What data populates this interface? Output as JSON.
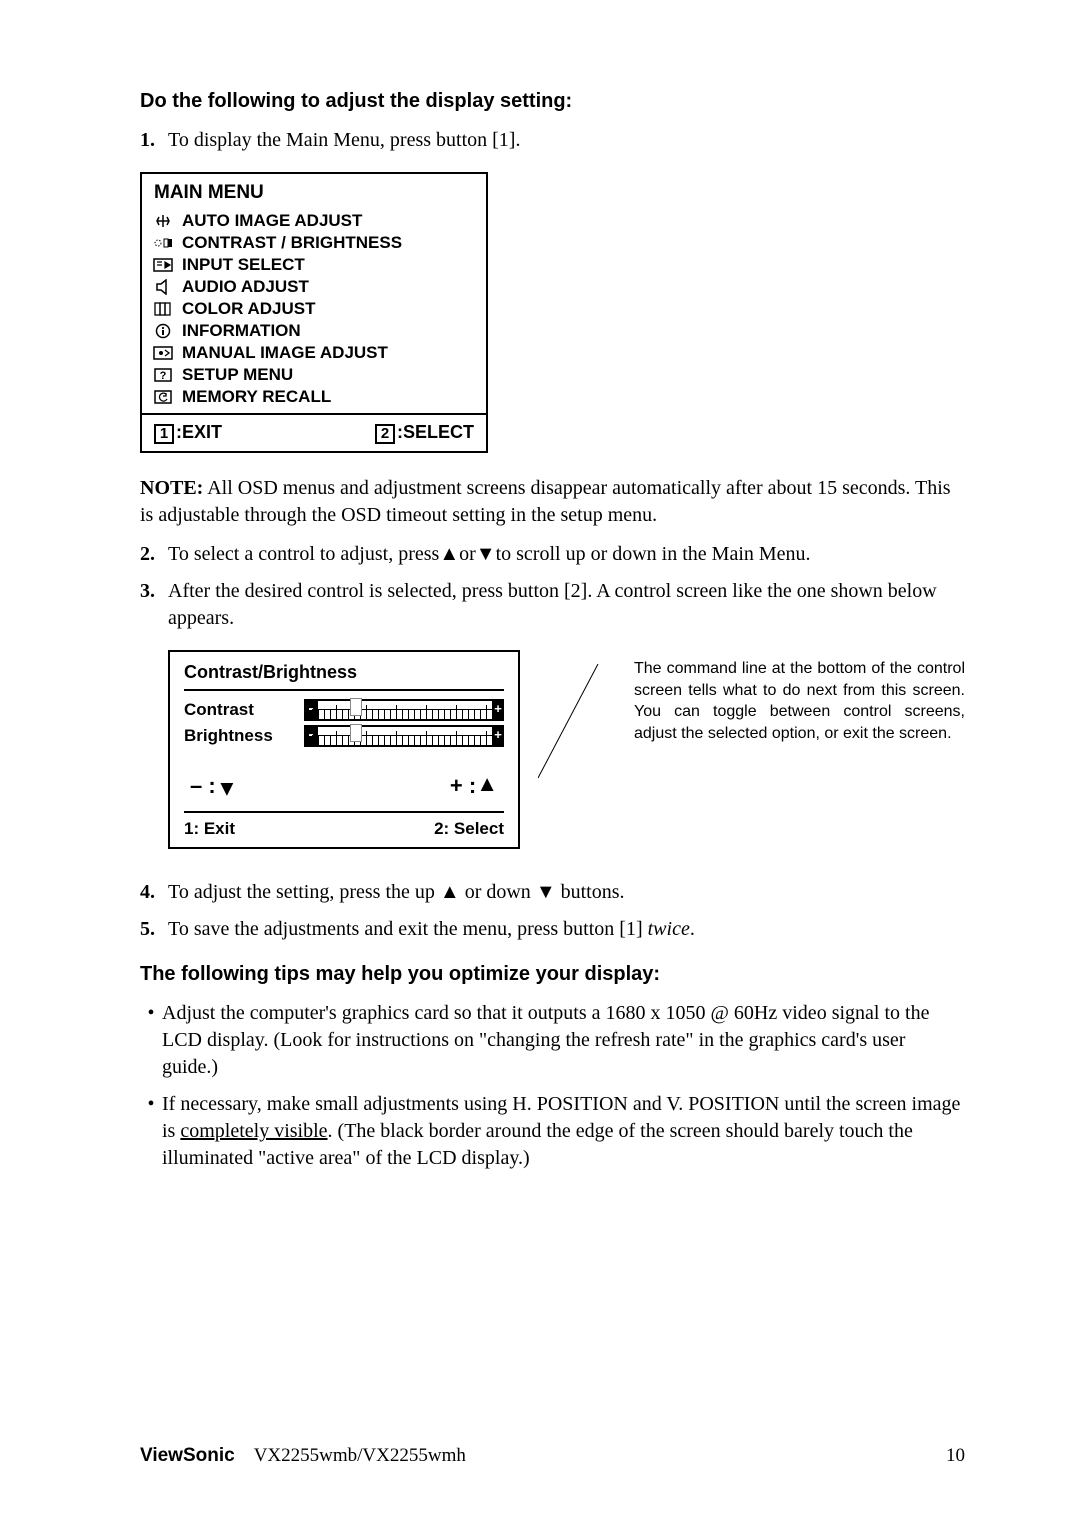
{
  "heading1": "Do the following to adjust the display setting:",
  "step1_num": "1.",
  "step1_body": "To display the Main Menu, press button [1].",
  "main_menu": {
    "title": "MAIN MENU",
    "items": [
      "AUTO IMAGE ADJUST",
      "CONTRAST / BRIGHTNESS",
      "INPUT SELECT",
      "AUDIO ADJUST",
      "COLOR ADJUST",
      "INFORMATION",
      "MANUAL IMAGE ADJUST",
      "SETUP MENU",
      "MEMORY RECALL"
    ],
    "footer_exit_key": "1",
    "footer_exit_label": ":EXIT",
    "footer_select_key": "2",
    "footer_select_label": ":SELECT"
  },
  "note_label": "NOTE:",
  "note_body": " All OSD menus and adjustment screens disappear automatically after about 15 seconds. This is adjustable through the OSD timeout setting in the setup menu.",
  "step2_num": "2.",
  "step2_a": "To select a control to adjust, press",
  "step2_up": "▲",
  "step2_or": "or",
  "step2_down": "▼",
  "step2_b": "to scroll up or down in the Main Menu.",
  "step3_num": "3.",
  "step3_body": "After the desired control is selected, press button [2]. A control screen like the one shown below appears.",
  "cb": {
    "title": "Contrast/Brightness",
    "row1": "Contrast",
    "row2": "Brightness",
    "minus": "– :",
    "minus_arrow": "▼",
    "plus": "+ :",
    "plus_arrow": "▲",
    "exit": "1: Exit",
    "select": "2: Select"
  },
  "cb_caption": "The command line at the bottom of the control screen tells what to do next from this screen. You can toggle between control screens, adjust the selected option, or exit the screen.",
  "step4_num": "4.",
  "step4_a": "To adjust the setting, press the up ",
  "step4_up": "▲",
  "step4_mid": " or down ",
  "step4_down": "▼",
  "step4_b": " buttons.",
  "step5_num": "5.",
  "step5_a": "To save the adjustments and exit the menu, press button [1] ",
  "step5_twice": "twice",
  "step5_b": ".",
  "heading2": "The following tips may help you optimize your display:",
  "tip1": "Adjust the computer's graphics card so that it outputs a 1680 x 1050 @ 60Hz video signal to the LCD display. (Look for instructions on \"changing the refresh rate\" in the graphics card's user guide.)",
  "tip2_a": "If necessary, make small adjustments using H. POSITION and V. POSITION until the screen image is ",
  "tip2_u": "completely visible",
  "tip2_b": ". (The black border around the edge of the screen should barely touch the illuminated \"active area\" of the LCD display.)",
  "footer_brand": "ViewSonic",
  "footer_model": "VX2255wmb/VX2255wmh",
  "footer_page": "10"
}
